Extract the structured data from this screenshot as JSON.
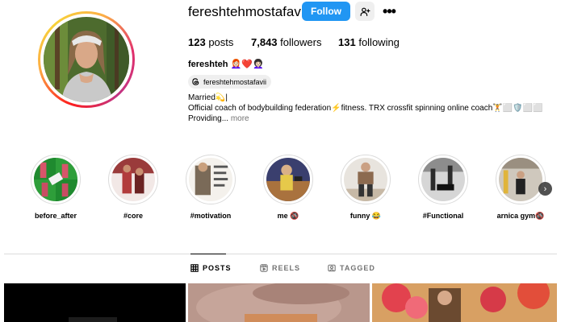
{
  "profile": {
    "username": "fereshtehmostafavii",
    "follow_label": "Follow",
    "stats": [
      {
        "count": "123",
        "label": "posts"
      },
      {
        "count": "7,843",
        "label": "followers"
      },
      {
        "count": "131",
        "label": "following"
      }
    ],
    "full_name": "fereshteh 👩🏻‍🦰❤️👩🏻‍🦱",
    "threads_handle": "fereshtehmostafavii",
    "bio_lines": [
      "Married💫|",
      "Official coach of bodybuilding federation⚡fitness. TRX crossfit spinning online coach🏋️⬜🛡️⬜⬜",
      "Providing..."
    ],
    "bio_more": "more"
  },
  "highlights": [
    {
      "label": "before_after"
    },
    {
      "label": "#core"
    },
    {
      "label": "#motivation"
    },
    {
      "label": "me 🚳"
    },
    {
      "label": "funny 😂"
    },
    {
      "label": "#Functional"
    },
    {
      "label": "arnica gym🚳"
    }
  ],
  "tabs": [
    {
      "label": "POSTS",
      "icon": "grid-icon",
      "active": true
    },
    {
      "label": "REELS",
      "icon": "reels-icon",
      "active": false
    },
    {
      "label": "TAGGED",
      "icon": "tagged-icon",
      "active": false
    }
  ],
  "colors": {
    "follow_button": "#2196f3",
    "accent_ring": "#e1306c",
    "divider": "#dbdbdb",
    "muted_text": "#737373"
  }
}
